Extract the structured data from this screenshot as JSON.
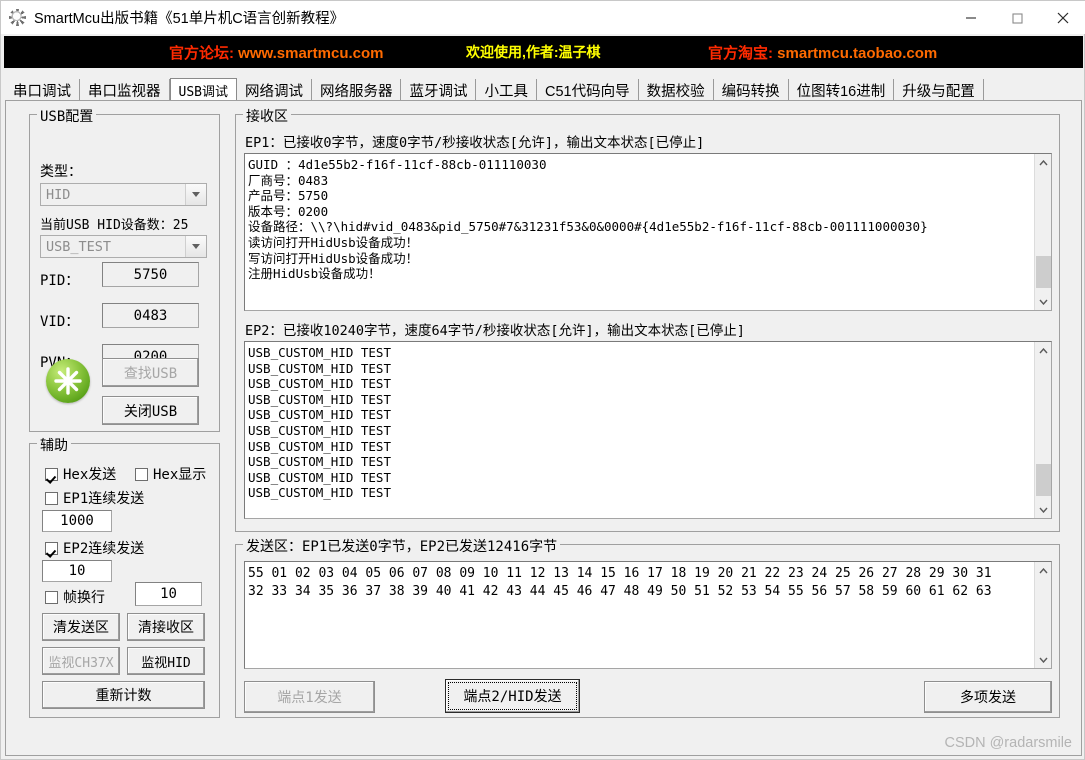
{
  "window": {
    "title": "SmartMcu出版书籍《51单片机C语言创新教程》",
    "icon": "gear-icon",
    "minimize": "—",
    "maximize": "□",
    "close": "✕"
  },
  "banner": {
    "forum_label": "官方论坛:",
    "forum_url": "www.smartmcu.com",
    "welcome": "欢迎使用,作者:温子棋",
    "taobao_label": "官方淘宝:",
    "taobao_url": "smartmcu.taobao.com",
    "colors": {
      "red": "#ff2a00",
      "orange": "#ff6a00",
      "yellow": "#ffff00",
      "background": "#000000"
    }
  },
  "tabs": [
    {
      "label": "串口调试",
      "selected": false
    },
    {
      "label": "串口监视器",
      "selected": false
    },
    {
      "label": "USB调试",
      "selected": true
    },
    {
      "label": "网络调试",
      "selected": false
    },
    {
      "label": "网络服务器",
      "selected": false
    },
    {
      "label": "蓝牙调试",
      "selected": false
    },
    {
      "label": "小工具",
      "selected": false
    },
    {
      "label": "C51代码向导",
      "selected": false
    },
    {
      "label": "数据校验",
      "selected": false
    },
    {
      "label": "编码转换",
      "selected": false
    },
    {
      "label": "位图转16进制",
      "selected": false
    },
    {
      "label": "升级与配置",
      "selected": false
    }
  ],
  "usb_config": {
    "group_title": "USB配置",
    "type_label": "类型：",
    "type_value": "HID",
    "device_count_label": "当前USB HID设备数：25",
    "device_value": "USB_TEST",
    "pid_label": "PID：",
    "pid_value": "5750",
    "vid_label": "VID：",
    "vid_value": "0483",
    "pvn_label": "PVN：",
    "pvn_value": "0200",
    "find_usb_button": "查找USB",
    "close_usb_button": "关闭USB",
    "status_icon": "green-status-orb-icon"
  },
  "aux": {
    "group_title": "辅助",
    "hex_send": {
      "label": "Hex发送",
      "checked": true
    },
    "hex_show": {
      "label": "Hex显示",
      "checked": false
    },
    "ep1_continuous": {
      "label": "EP1连续发送",
      "checked": false
    },
    "ep1_interval": "1000",
    "ep2_continuous": {
      "label": "EP2连续发送",
      "checked": true
    },
    "ep2_interval": "10",
    "frame_newline": {
      "label": "帧换行",
      "checked": false
    },
    "frame_value": "10",
    "clear_send_button": "清发送区",
    "clear_recv_button": "清接收区",
    "monitor_ch37x_button": "监视CH37X",
    "monitor_hid_button": "监视HID",
    "recount_button": "重新计数"
  },
  "receive": {
    "group_title": "接收区",
    "ep1_status": "EP1：已接收0字节，速度0字节/秒接收状态[允许]，输出文本状态[已停止]",
    "ep1_text": "GUID ：4d1e55b2-f16f-11cf-88cb-011110030\n厂商号：0483\n产品号：5750\n版本号：0200\n设备路径：\\\\?\\hid#vid_0483&pid_5750#7&31231f53&0&0000#{4d1e55b2-f16f-11cf-88cb-001111000030}\n读访问打开HidUsb设备成功！\n写访问打开HidUsb设备成功！\n注册HidUsb设备成功！",
    "ep2_status": "EP2：已接收10240字节，速度64字节/秒接收状态[允许]，输出文本状态[已停止]",
    "ep2_text": "USB_CUSTOM_HID TEST\nUSB_CUSTOM_HID TEST\nUSB_CUSTOM_HID TEST\nUSB_CUSTOM_HID TEST\nUSB_CUSTOM_HID TEST\nUSB_CUSTOM_HID TEST\nUSB_CUSTOM_HID TEST\nUSB_CUSTOM_HID TEST\nUSB_CUSTOM_HID TEST\nUSB_CUSTOM_HID TEST"
  },
  "send": {
    "group_title": "发送区：EP1已发送0字节，EP2已发送12416字节",
    "text": "55 01 02 03 04 05 06 07 08 09 10 11 12 13 14 15 16 17 18 19 20 21 22 23 24 25 26 27 28 29 30 31\n32 33 34 35 36 37 38 39 40 41 42 43 44 45 46 47 48 49 50 51 52 53 54 55 56 57 58 59 60 61 62 63",
    "ep1_send_button": "端点1发送",
    "ep2_send_button": "端点2/HID发送",
    "multi_send_button": "多项发送"
  },
  "watermark": "CSDN @radarsmile"
}
